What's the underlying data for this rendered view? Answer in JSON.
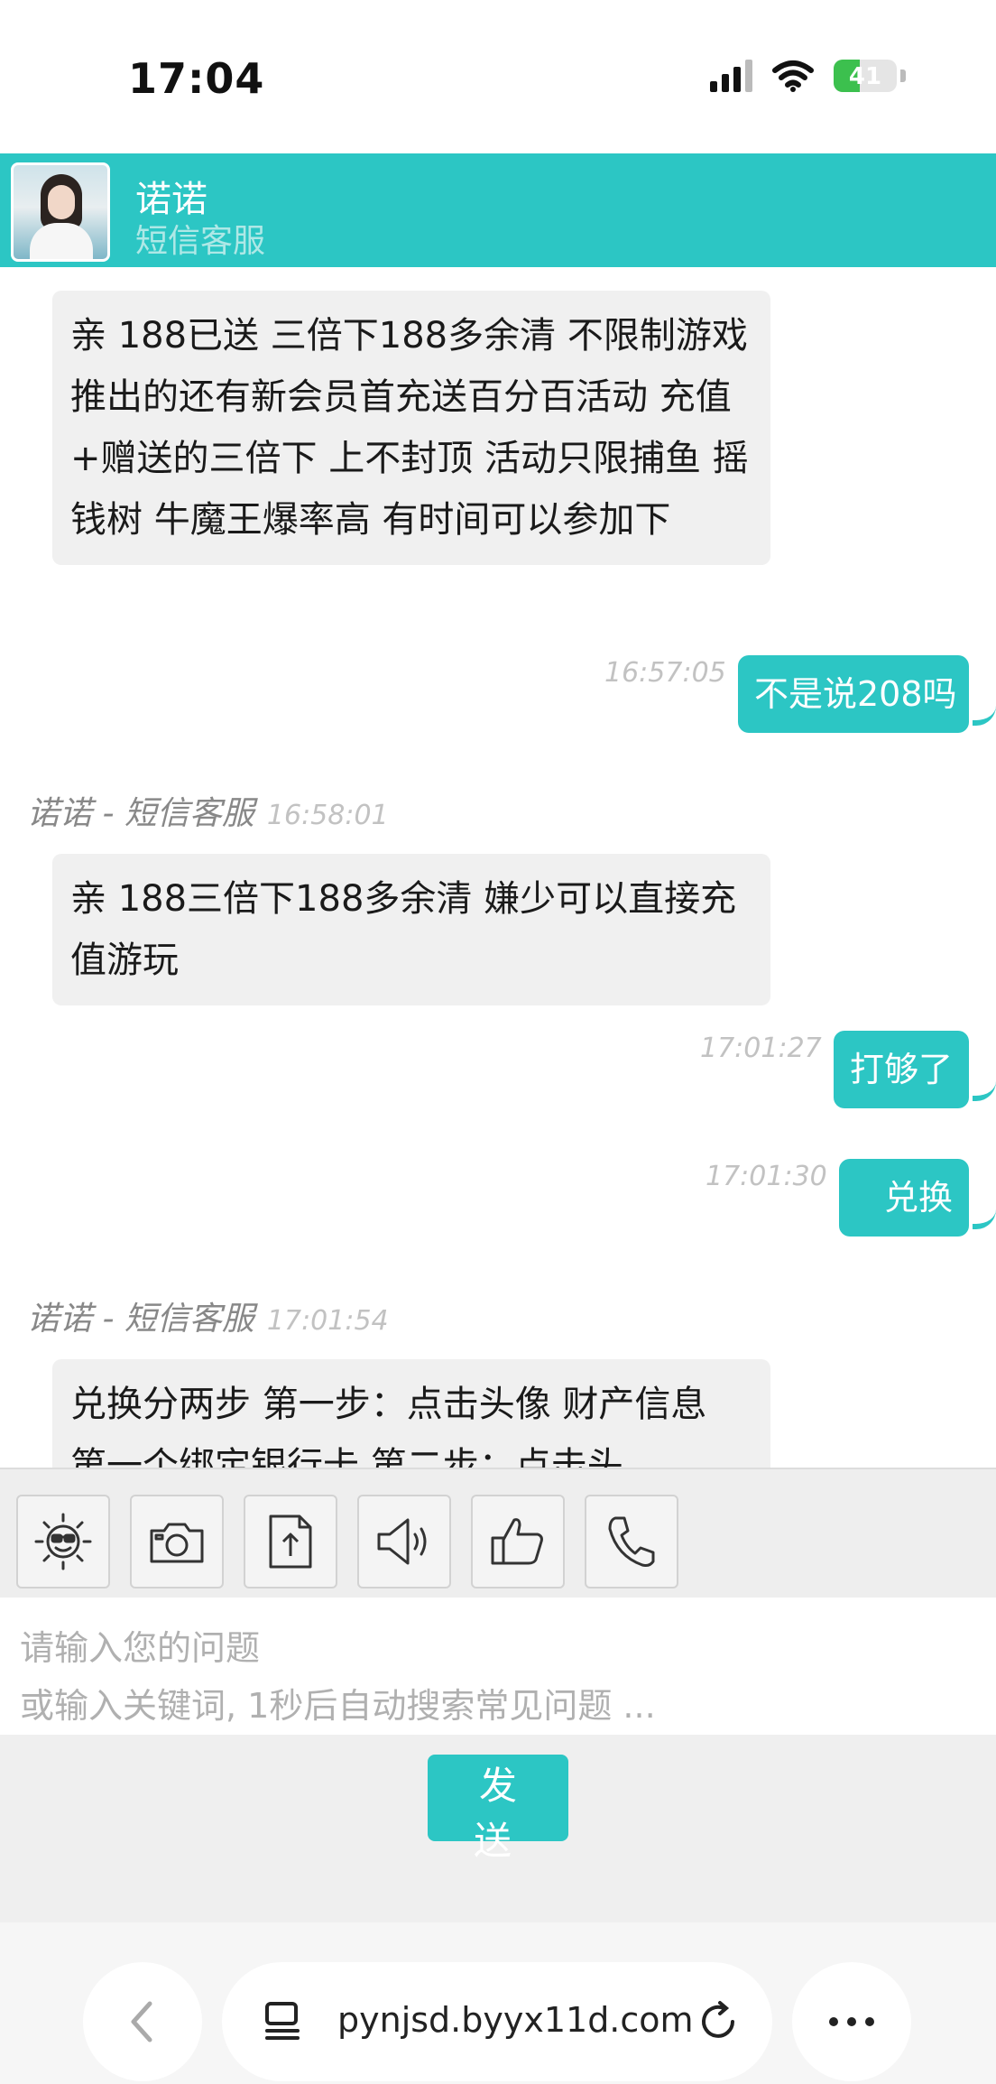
{
  "status_bar": {
    "time": "17:04",
    "battery": "41",
    "battery_level": 0.41,
    "battery_color": "#3cc04e"
  },
  "header": {
    "name": "诺诺",
    "subtitle": "短信客服",
    "accent": "#2cc6c4"
  },
  "messages": [
    {
      "direction": "in",
      "text": "亲 188已送 三倍下188多余清 不限制游戏 推出的还有新会员首充送百分百活动 充值+赠送的三倍下 上不封顶 活动只限捕鱼 摇钱树 牛魔王爆率高 有时间可以参加下"
    },
    {
      "direction": "out",
      "time": "16:57:05",
      "text": "不是说208吗"
    },
    {
      "direction": "in",
      "sender": "诺诺 - 短信客服",
      "time": "16:58:01",
      "text": "亲 188三倍下188多余清 嫌少可以直接充值游玩"
    },
    {
      "direction": "out",
      "time": "17:01:27",
      "text": "打够了"
    },
    {
      "direction": "out",
      "time": "17:01:30",
      "text": "兑换"
    },
    {
      "direction": "in",
      "sender": "诺诺 - 短信客服",
      "time": "17:01:54",
      "text": "兑换分两步 第一步：点击头像 财产信息 第一个绑定银行卡 第二步：点击头"
    }
  ],
  "toolbar": {
    "tools": [
      {
        "icon": "emoji-sun-icon"
      },
      {
        "icon": "camera-icon"
      },
      {
        "icon": "upload-file-icon"
      },
      {
        "icon": "speaker-icon"
      },
      {
        "icon": "thumbs-up-icon"
      },
      {
        "icon": "phone-icon"
      }
    ]
  },
  "input": {
    "placeholder": "请输入您的问题\n或输入关键词, 1秒后自动搜索常见问题 ..."
  },
  "send_button": "发 送",
  "browser": {
    "url": "pynjsd.byyx11d.com"
  }
}
